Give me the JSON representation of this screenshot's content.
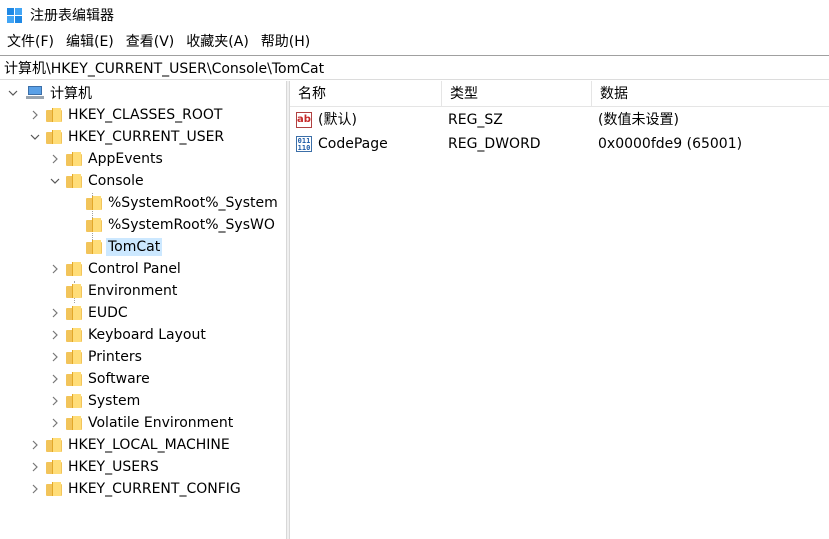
{
  "window": {
    "title": "注册表编辑器",
    "app_icon": "registry-editor-icon"
  },
  "menu": [
    "文件(F)",
    "编辑(E)",
    "查看(V)",
    "收藏夹(A)",
    "帮助(H)"
  ],
  "address": "计算机\\HKEY_CURRENT_USER\\Console\\TomCat",
  "tree": {
    "root": "计算机",
    "items": [
      "HKEY_CLASSES_ROOT",
      "HKEY_CURRENT_USER",
      "AppEvents",
      "Console",
      "%SystemRoot%_System",
      "%SystemRoot%_SysWO",
      "TomCat",
      "Control Panel",
      "Environment",
      "EUDC",
      "Keyboard Layout",
      "Printers",
      "Software",
      "System",
      "Volatile Environment",
      "HKEY_LOCAL_MACHINE",
      "HKEY_USERS",
      "HKEY_CURRENT_CONFIG"
    ],
    "selected": "TomCat"
  },
  "list": {
    "headers": {
      "name": "名称",
      "type": "类型",
      "data": "数据"
    },
    "rows": [
      {
        "icon": "string-value-icon",
        "name": "(默认)",
        "type": "REG_SZ",
        "data": "(数值未设置)"
      },
      {
        "icon": "binary-value-icon",
        "name": "CodePage",
        "type": "REG_DWORD",
        "data": "0x0000fde9 (65001)"
      }
    ]
  }
}
